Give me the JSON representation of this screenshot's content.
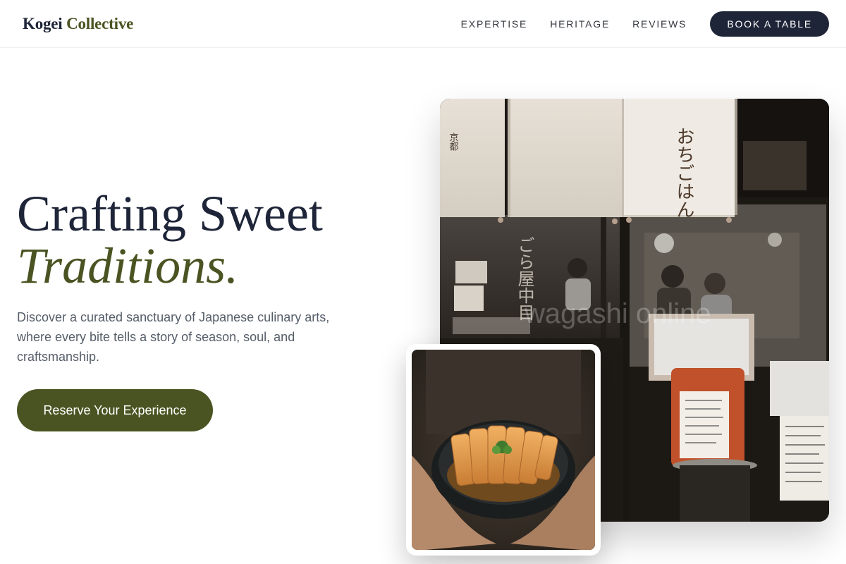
{
  "header": {
    "logo_primary": "Kogei",
    "logo_secondary": "Collective",
    "nav": [
      {
        "label": "EXPERTISE"
      },
      {
        "label": "HERITAGE"
      },
      {
        "label": "REVIEWS"
      }
    ],
    "cta_label": "BOOK A TABLE"
  },
  "hero": {
    "title_line1": "Crafting Sweet",
    "title_line2": "Traditions.",
    "subtitle": "Discover a curated sanctuary of Japanese culinary arts, where every bite tells a story of season, soul, and craftsmanship.",
    "cta_label": "Reserve Your Experience"
  },
  "images": {
    "main_watermark": "wagashi online",
    "curtain_right_text": "おちごはん",
    "curtain_left_text": "京都",
    "window_sign_text": "ごら屋中目"
  },
  "colors": {
    "navy": "#1e2538",
    "olive": "#4a5422",
    "body_text": "#555d68"
  }
}
